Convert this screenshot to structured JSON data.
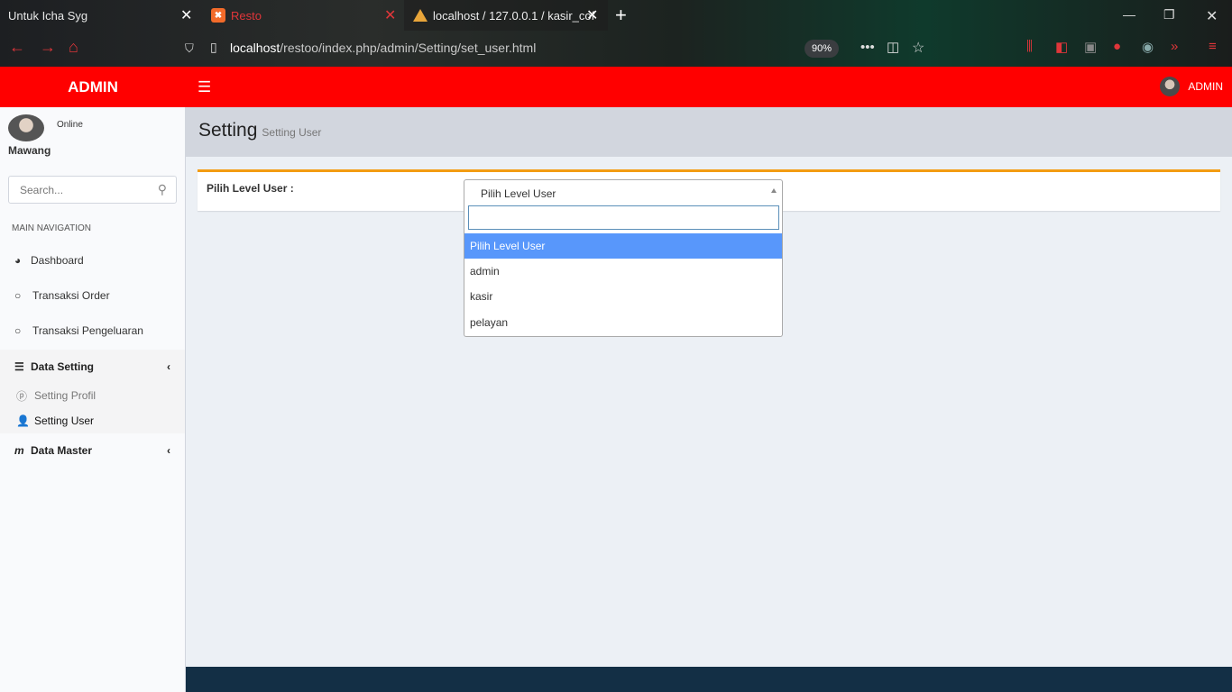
{
  "browser": {
    "tabs": [
      {
        "title": "Untuk Icha Syg"
      },
      {
        "title": "Resto"
      },
      {
        "title": "localhost / 127.0.0.1 / kasir_cof"
      }
    ],
    "url_host": "localhost",
    "url_path": "/restoo/index.php/admin/Setting/set_user.html",
    "zoom": "90%"
  },
  "header": {
    "logo": "ADMIN",
    "user": "ADMIN"
  },
  "sidebar": {
    "status": "Online",
    "username": "Mawang",
    "search_placeholder": "Search...",
    "section": "MAIN NAVIGATION",
    "items": [
      {
        "label": "Dashboard"
      },
      {
        "label": "Transaksi Order"
      },
      {
        "label": "Transaksi Pengeluaran"
      },
      {
        "label": "Data Setting"
      },
      {
        "label": "Data Master"
      }
    ],
    "subitems": [
      {
        "label": "Setting Profil"
      },
      {
        "label": "Setting User"
      }
    ]
  },
  "page": {
    "title": "Setting",
    "subtitle": "Setting User",
    "field_label": "Pilih Level User :",
    "select_value": "Pilih Level User",
    "options": [
      "Pilih Level User",
      "admin",
      "kasir",
      "pelayan"
    ]
  }
}
